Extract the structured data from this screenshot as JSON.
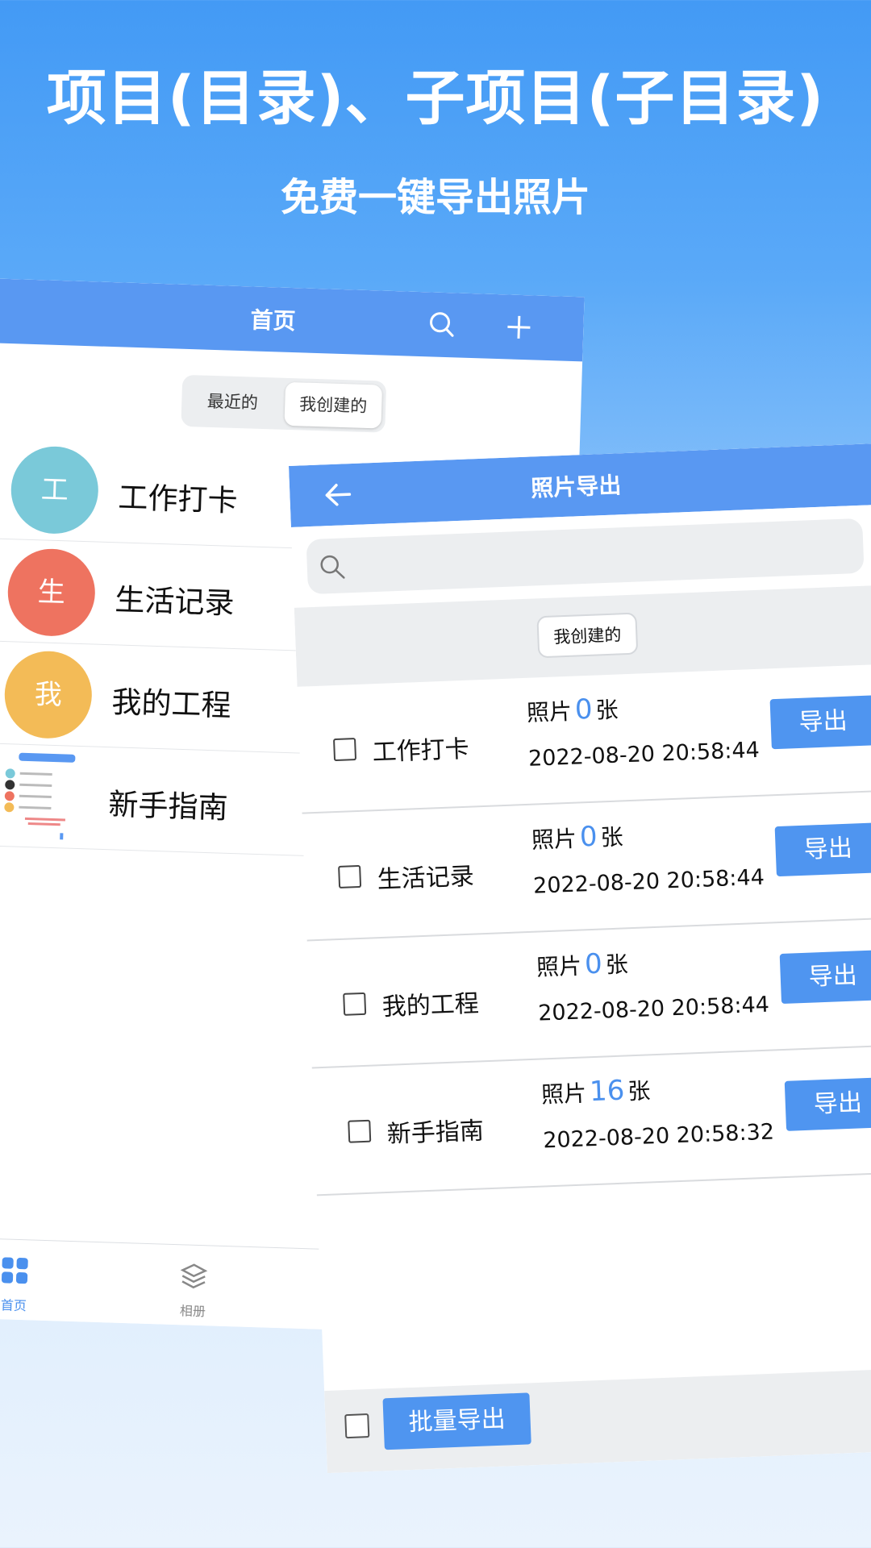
{
  "promo": {
    "headline": "项目(目录)、子项目(子目录)",
    "subline": "免费一键导出照片"
  },
  "home": {
    "title": "首页",
    "search_icon": "search-icon",
    "add_icon": "plus-icon",
    "segments": [
      "最近的",
      "我创建的"
    ],
    "projects": [
      {
        "avatar": "工",
        "name": "工作打卡",
        "color": "#7ac9d9"
      },
      {
        "avatar": "生",
        "name": "生活记录",
        "color": "#ee7360"
      },
      {
        "avatar": "我",
        "name": "我的工程",
        "color": "#f3bb57"
      },
      {
        "avatar": "",
        "name": "新手指南",
        "color": "#ffffff"
      }
    ],
    "tabs": [
      {
        "label": "首页",
        "icon": "grid-icon",
        "active": true
      },
      {
        "label": "相册",
        "icon": "layers-icon",
        "active": false
      }
    ],
    "accent": "#5998f2"
  },
  "export": {
    "title": "照片导出",
    "back_icon": "arrow-left-icon",
    "search_placeholder": "",
    "filter": "我创建的",
    "count_prefix": "照片",
    "count_suffix": "张",
    "export_label": "导出",
    "rows": [
      {
        "name": "工作打卡",
        "count": "0",
        "date": "2022-08-20 20:58:44"
      },
      {
        "name": "生活记录",
        "count": "0",
        "date": "2022-08-20 20:58:44"
      },
      {
        "name": "我的工程",
        "count": "0",
        "date": "2022-08-20 20:58:44"
      },
      {
        "name": "新手指南",
        "count": "16",
        "date": "2022-08-20 20:58:32"
      }
    ],
    "bulk_export": "批量导出",
    "button_color": "#4f95f0"
  }
}
